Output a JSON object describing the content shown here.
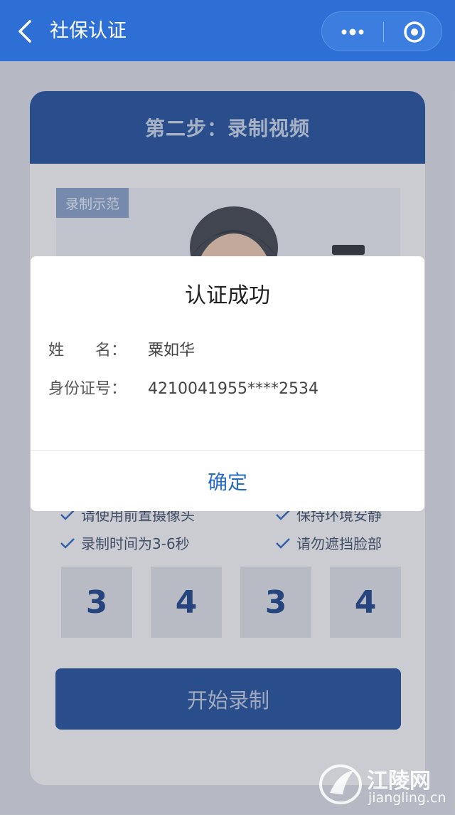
{
  "nav": {
    "title": "社保认证"
  },
  "card": {
    "step_title": "第二步：录制视频",
    "demo_tag": "录制示范",
    "tips": [
      {
        "left": "请使用前置摄像头",
        "right": "保持环境安静"
      },
      {
        "left": "录制时间为3-6秒",
        "right": "请勿遮挡脸部"
      }
    ],
    "digits": [
      "3",
      "4",
      "3",
      "4"
    ],
    "start_button": "开始录制"
  },
  "modal": {
    "title": "认证成功",
    "name_label": "姓　　名：",
    "name_value": "粟如华",
    "id_label": "身份证号：",
    "id_value": "4210041955****2534",
    "confirm_label": "确定"
  },
  "watermark": {
    "name": "江陵网",
    "url": "jiangling.cn"
  },
  "colors": {
    "nav": "#2d6fd4",
    "card_header": "#2f5aa0",
    "confirm": "#2a6cc4"
  }
}
